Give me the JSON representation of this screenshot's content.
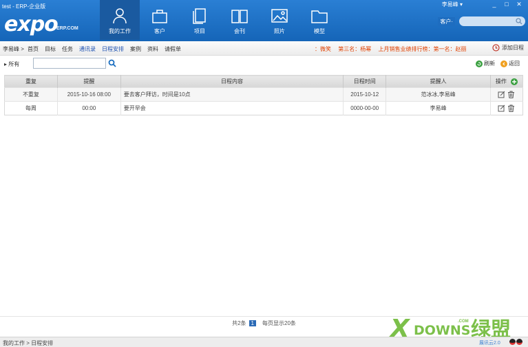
{
  "window": {
    "title": "test - ERP-企业版"
  },
  "logo": {
    "main": "expo",
    "sub": "ERP.COM"
  },
  "nav": [
    {
      "label": "我的工作",
      "icon": "person-icon"
    },
    {
      "label": "客户",
      "icon": "briefcase-icon"
    },
    {
      "label": "项目",
      "icon": "documents-icon"
    },
    {
      "label": "会刊",
      "icon": "book-icon"
    },
    {
      "label": "照片",
      "icon": "picture-icon"
    },
    {
      "label": "模型",
      "icon": "folder-icon"
    }
  ],
  "user": {
    "name": "李易峰 ▾"
  },
  "window_controls": {
    "minimize": "_",
    "maximize": "□",
    "close": "✕"
  },
  "search": {
    "type": "客户·",
    "placeholder": ""
  },
  "menubar": {
    "crumb": "李易峰 >",
    "links": [
      "首页",
      "目标",
      "任务",
      "通讯录",
      "日程安排",
      "案例",
      "资料",
      "请假单"
    ],
    "ticker": [
      "：微笑",
      "第三名：杨幂",
      "上月销售业绩排行榜：第一名：赵丽"
    ],
    "add_schedule": "添加日程"
  },
  "toolbar": {
    "filter_all": "所有",
    "refresh": "刷新",
    "back": "返回"
  },
  "table": {
    "headers": [
      "重复",
      "提醒",
      "日程内容",
      "日程时间",
      "提醒人",
      "操作"
    ],
    "rows": [
      {
        "repeat": "不重复",
        "remind": "2015-10-16 08:00",
        "content": "要去客户拜访，时间是10点",
        "date": "2015-10-12",
        "person": "范冰冰,李易峰"
      },
      {
        "repeat": "每周",
        "remind": "00:00",
        "content": "要开早会",
        "date": "0000-00-00",
        "person": "李易峰"
      }
    ]
  },
  "pager": {
    "total": "共2条",
    "page": "1",
    "per_page": "每页显示20条"
  },
  "statusbar": {
    "path": "我的工作 > 日程安排",
    "version": "展讯云2.0"
  },
  "watermark": {
    "x": "X",
    "downs": "DOWNS",
    "com": ".COM",
    "cn": "绿盟"
  }
}
